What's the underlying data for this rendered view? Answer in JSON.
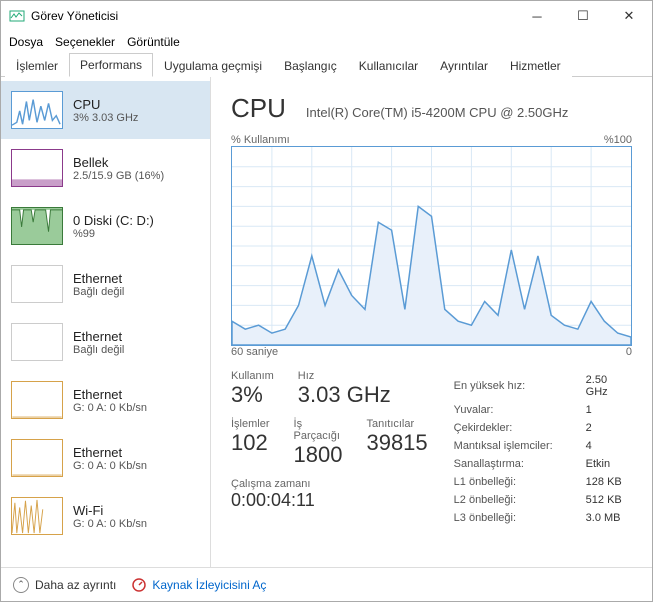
{
  "titlebar": {
    "title": "Görev Yöneticisi"
  },
  "menubar": {
    "file": "Dosya",
    "options": "Seçenekler",
    "view": "Görüntüle"
  },
  "tabs": {
    "processes": "İşlemler",
    "performance": "Performans",
    "apphistory": "Uygulama geçmişi",
    "startup": "Başlangıç",
    "users": "Kullanıcılar",
    "details": "Ayrıntılar",
    "services": "Hizmetler"
  },
  "sidebar": {
    "items": [
      {
        "name": "CPU",
        "sub": "3% 3.03 GHz"
      },
      {
        "name": "Bellek",
        "sub": "2.5/15.9 GB (16%)"
      },
      {
        "name": "0 Diski (C: D:)",
        "sub": "%99"
      },
      {
        "name": "Ethernet",
        "sub": "Bağlı değil"
      },
      {
        "name": "Ethernet",
        "sub": "Bağlı değil"
      },
      {
        "name": "Ethernet",
        "sub": "G: 0 A: 0 Kb/sn"
      },
      {
        "name": "Ethernet",
        "sub": "G: 0 A: 0 Kb/sn"
      },
      {
        "name": "Wi-Fi",
        "sub": "G: 0 A: 0 Kb/sn"
      }
    ]
  },
  "main": {
    "title": "CPU",
    "model": "Intel(R) Core(TM) i5-4200M CPU @ 2.50GHz",
    "chart_top_left": "% Kullanımı",
    "chart_top_right": "%100",
    "chart_bottom_left": "60 saniye",
    "chart_bottom_right": "0",
    "stats": {
      "usage_label": "Kullanım",
      "usage_value": "3%",
      "speed_label": "Hız",
      "speed_value": "3.03 GHz",
      "processes_label": "İşlemler",
      "processes_value": "102",
      "threads_label": "İş Parçacığı",
      "threads_value": "1800",
      "handles_label": "Tanıtıcılar",
      "handles_value": "39815",
      "uptime_label": "Çalışma zamanı",
      "uptime_value": "0:00:04:11"
    },
    "specs": {
      "maxspeed_label": "En yüksek hız:",
      "maxspeed_value": "2.50 GHz",
      "sockets_label": "Yuvalar:",
      "sockets_value": "1",
      "cores_label": "Çekirdekler:",
      "cores_value": "2",
      "logical_label": "Mantıksal işlemciler:",
      "logical_value": "4",
      "virt_label": "Sanallaştırma:",
      "virt_value": "Etkin",
      "l1_label": "L1 önbelleği:",
      "l1_value": "128 KB",
      "l2_label": "L2 önbelleği:",
      "l2_value": "512 KB",
      "l3_label": "L3 önbelleği:",
      "l3_value": "3.0 MB"
    }
  },
  "footer": {
    "brief": "Daha az ayrıntı",
    "resmon": "Kaynak İzleyicisini Aç"
  },
  "chart_data": {
    "type": "area",
    "title": "% Kullanımı",
    "xlabel": "saniye",
    "ylabel": "% Kullanımı",
    "xlim": [
      60,
      0
    ],
    "ylim": [
      0,
      100
    ],
    "x": [
      60,
      58,
      56,
      54,
      52,
      50,
      48,
      46,
      44,
      42,
      40,
      38,
      36,
      34,
      32,
      30,
      28,
      26,
      24,
      22,
      20,
      18,
      16,
      14,
      12,
      10,
      8,
      6,
      4,
      2,
      0
    ],
    "values": [
      12,
      8,
      10,
      6,
      8,
      20,
      45,
      20,
      38,
      25,
      18,
      62,
      58,
      18,
      70,
      65,
      18,
      12,
      10,
      22,
      15,
      48,
      18,
      45,
      15,
      10,
      8,
      22,
      12,
      6,
      4
    ]
  }
}
